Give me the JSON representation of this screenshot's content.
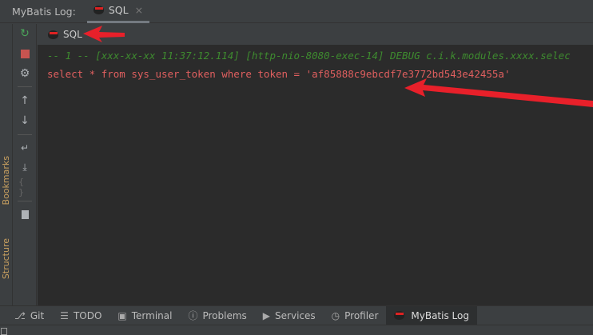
{
  "header": {
    "title": "MyBatis Log:",
    "tab": {
      "label": "SQL",
      "icon": "ninja-icon",
      "close": "×"
    }
  },
  "left_stripe": [
    "Bookmarks",
    "Structure"
  ],
  "toolbar": [
    {
      "icon": "rerun-icon"
    },
    {
      "icon": "stop-icon"
    },
    {
      "icon": "gear-icon"
    },
    {
      "icon": "arrow-up-icon"
    },
    {
      "icon": "arrow-down-icon"
    },
    {
      "icon": "soft-wrap-icon"
    },
    {
      "icon": "scroll-to-end-icon"
    },
    {
      "icon": "format-braces-icon"
    },
    {
      "icon": "trash-icon"
    }
  ],
  "subheader": {
    "label": "SQL"
  },
  "log": {
    "line1": "-- 1 -- [xxx-xx-xx 11:37:12.114] [http-nio-8080-exec-14] DEBUG c.i.k.modules.xxxx.selec",
    "line2": "select * from sys_user_token where token = 'af85888c9ebcdf7e3772bd543e42455a'"
  },
  "bottom_tabs": [
    {
      "label": "Git",
      "icon": "git-branch-icon"
    },
    {
      "label": "TODO",
      "icon": "list-icon"
    },
    {
      "label": "Terminal",
      "icon": "terminal-icon"
    },
    {
      "label": "Problems",
      "icon": "alert-icon"
    },
    {
      "label": "Services",
      "icon": "services-icon"
    },
    {
      "label": "Profiler",
      "icon": "profiler-icon"
    },
    {
      "label": "MyBatis Log",
      "icon": "ninja-icon",
      "active": true
    }
  ],
  "colors": {
    "annotation": "#e8202a",
    "comment": "#3e8b2f",
    "sql": "#e05f5f"
  }
}
